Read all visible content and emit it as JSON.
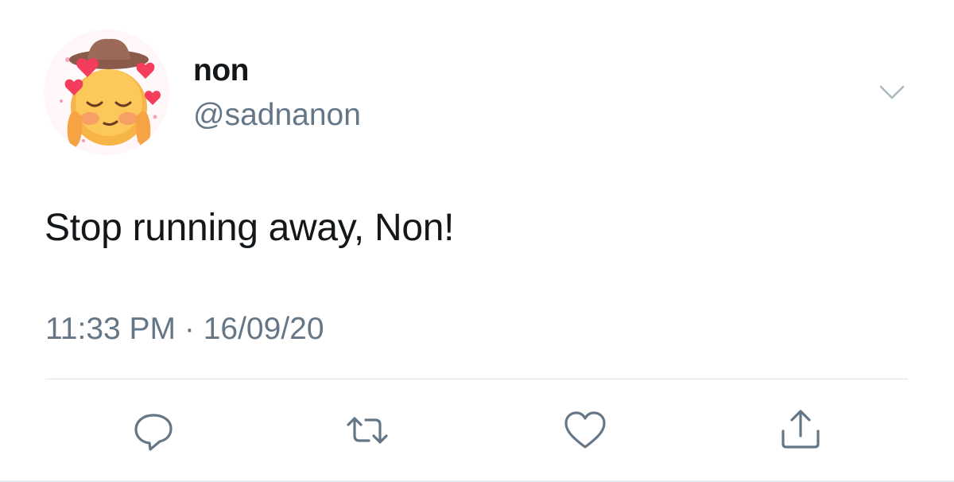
{
  "tweet": {
    "display_name": "non",
    "handle": "@sadnanon",
    "text": "Stop running away, Non!",
    "time": "11:33 PM",
    "separator": " · ",
    "date": "16/09/20"
  },
  "avatar": {
    "icon": "blushing-emoji-with-hearts-and-cowboy-hat"
  },
  "actions": [
    {
      "name": "reply",
      "icon": "reply-icon"
    },
    {
      "name": "retweet",
      "icon": "retweet-icon"
    },
    {
      "name": "like",
      "icon": "heart-icon"
    },
    {
      "name": "share",
      "icon": "share-icon"
    }
  ],
  "colors": {
    "primary_text": "#14171a",
    "secondary_text": "#657786",
    "divider": "#dfe3e6"
  }
}
